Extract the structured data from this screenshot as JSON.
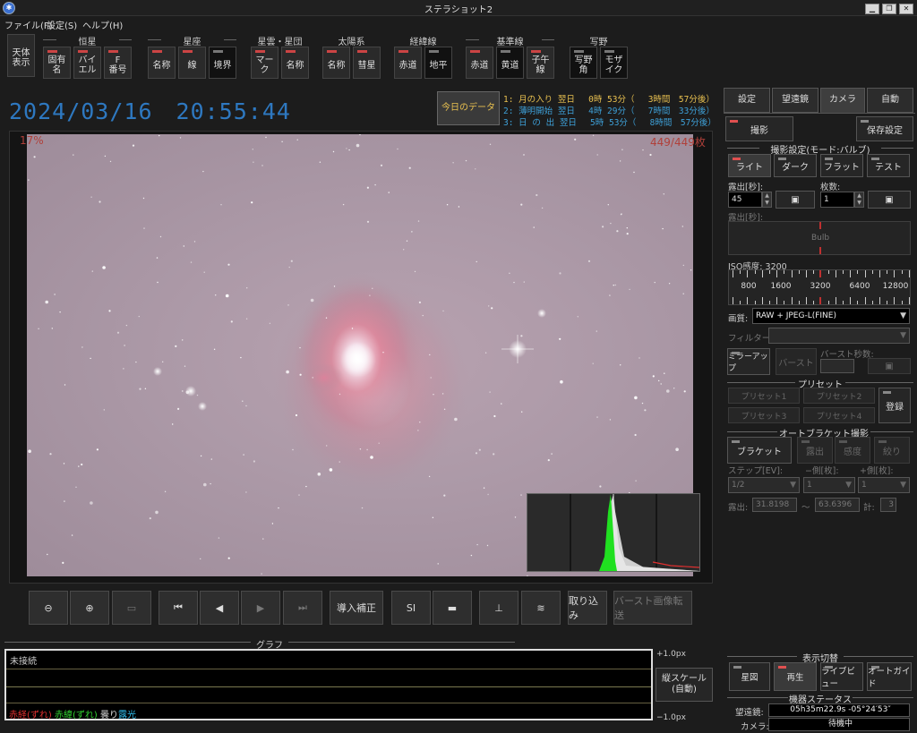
{
  "window": {
    "title": "ステラショット2"
  },
  "menu": [
    "ファイル(F)",
    "設定(S)",
    "ヘルプ(H)"
  ],
  "toolbar": {
    "celestial": "天体\n表示",
    "groups": [
      {
        "label": "恒星",
        "buttons": [
          "固有\n名",
          "バイ\nエル",
          "F\n番号"
        ]
      },
      {
        "label": "星座",
        "buttons": [
          "名称",
          "線",
          "境界"
        ]
      },
      {
        "label": "星雲・星団",
        "buttons": [
          "マーク",
          "名称"
        ]
      },
      {
        "label": "太陽系",
        "buttons": [
          "名称",
          "彗星"
        ]
      },
      {
        "label": "経緯線",
        "buttons": [
          "赤道",
          "地平"
        ]
      },
      {
        "label": "基準線",
        "buttons": [
          "赤道",
          "黄道",
          "子午\n線"
        ]
      },
      {
        "label": "写野",
        "buttons": [
          "写野\n角",
          "モザ\nイク"
        ]
      }
    ]
  },
  "datetime": "2024/03/16　20:55:44",
  "today_button": "今日のデータ",
  "events": [
    {
      "text": "1: 月の入り 翌日　 0時 53分（　 3時間　57分後）",
      "color": "#e8c050"
    },
    {
      "text": "2: 薄明開始 翌日　 4時 29分（　 7時間　33分後）",
      "color": "#3ea0d8"
    },
    {
      "text": "3: 日 の 出 翌日　 5時 53分（　 8時間　57分後）",
      "color": "#3ea0d8"
    }
  ],
  "image": {
    "percent": "17%",
    "count": "449/449枚"
  },
  "bottom_buttons": [
    {
      "name": "zoom-out-button",
      "label": "⊖",
      "dis": false
    },
    {
      "name": "zoom-in-button",
      "label": "⊕",
      "dis": false
    },
    {
      "name": "fit-button",
      "label": "▭",
      "dis": true
    },
    {
      "name": "first-frame-button",
      "label": "⏮",
      "dis": false
    },
    {
      "name": "prev-frame-button",
      "label": "◀",
      "dis": false
    },
    {
      "name": "next-frame-button",
      "label": "▶",
      "dis": true
    },
    {
      "name": "last-frame-button",
      "label": "⏭",
      "dis": true
    },
    {
      "name": "guide-correction-button",
      "label": "導入補正",
      "dis": false
    },
    {
      "name": "si-button",
      "label": "SI",
      "dis": false
    },
    {
      "name": "folder-button",
      "label": "▬",
      "dis": false
    },
    {
      "name": "histogram-button",
      "label": "⊥",
      "dis": false
    },
    {
      "name": "stretch-button",
      "label": "≋",
      "dis": false
    },
    {
      "name": "import-button",
      "label": "取り込み",
      "dis": false
    },
    {
      "name": "burst-transfer-button",
      "label": "バースト画像転送",
      "dis": true
    }
  ],
  "graph": {
    "title": "グラフ",
    "status": "未接続",
    "upper": "+1.0px",
    "lower": "−1.0px",
    "scale_button": "縦スケール\n(自動)",
    "legend": [
      {
        "text": "赤経(ずれ)",
        "color": "#e03030"
      },
      {
        "text": "赤緯(ずれ)",
        "color": "#30d030"
      },
      {
        "text": "曇り",
        "color": "#d8d8d8"
      },
      {
        "text": "露光",
        "color": "#30c0f0"
      }
    ]
  },
  "panel": {
    "tabs": [
      "設定",
      "望遠鏡",
      "カメラ",
      "自動"
    ],
    "shoot": "撮影",
    "save_settings": "保存設定",
    "shoot_section": "撮影設定(モード:バルブ)",
    "modes": [
      "ライト",
      "ダーク",
      "フラット",
      "テスト"
    ],
    "exposure_label": "露出[秒]:",
    "exposure_value": "45",
    "frames_label": "枚数:",
    "frames_value": "1",
    "exposure2_label": "露出[秒]:",
    "bulb": "Bulb",
    "iso_label": "ISO感度: 3200",
    "iso_ticks": [
      "800",
      "1600",
      "3200",
      "6400",
      "12800"
    ],
    "quality_label": "画質:",
    "quality_value": "RAW + JPEG-L(FINE)",
    "filter_label": "フィルター:",
    "mirror_up": "ミラーアップ",
    "burst": "バースト",
    "burst_sec_label": "バースト秒数:",
    "preset_section": "プリセット",
    "presets": [
      "プリセット1",
      "プリセット2",
      "プリセット3",
      "プリセット4"
    ],
    "register": "登録",
    "bracket_section": "オートブラケット撮影",
    "bracket": "ブラケット",
    "bracket_opts": [
      "露出",
      "感度",
      "絞り"
    ],
    "step_label": "ステップ[EV]:",
    "minus_label": "−側[枚]:",
    "plus_label": "+側[枚]:",
    "step_value": "1/2",
    "minus_value": "1",
    "plus_value": "1",
    "exp_label": "露出:",
    "exp_min": "31.8198",
    "tilde": "〜",
    "exp_max": "63.6396",
    "total_label": "計:",
    "total_value": "3",
    "display_section": "表示切替",
    "display_btns": [
      "星図",
      "再生",
      "ライブビュー",
      "オートガイド"
    ],
    "status_section": "機器ステータス",
    "telescope_label": "望遠鏡:",
    "telescope_value": "05h35m22.9s -05°24′53″",
    "camera_label": "カメラ:",
    "camera_value": "待機中"
  },
  "colors": {
    "accent": "#2e78c0",
    "led_red": "#e05050",
    "warning": "#b0403a"
  }
}
